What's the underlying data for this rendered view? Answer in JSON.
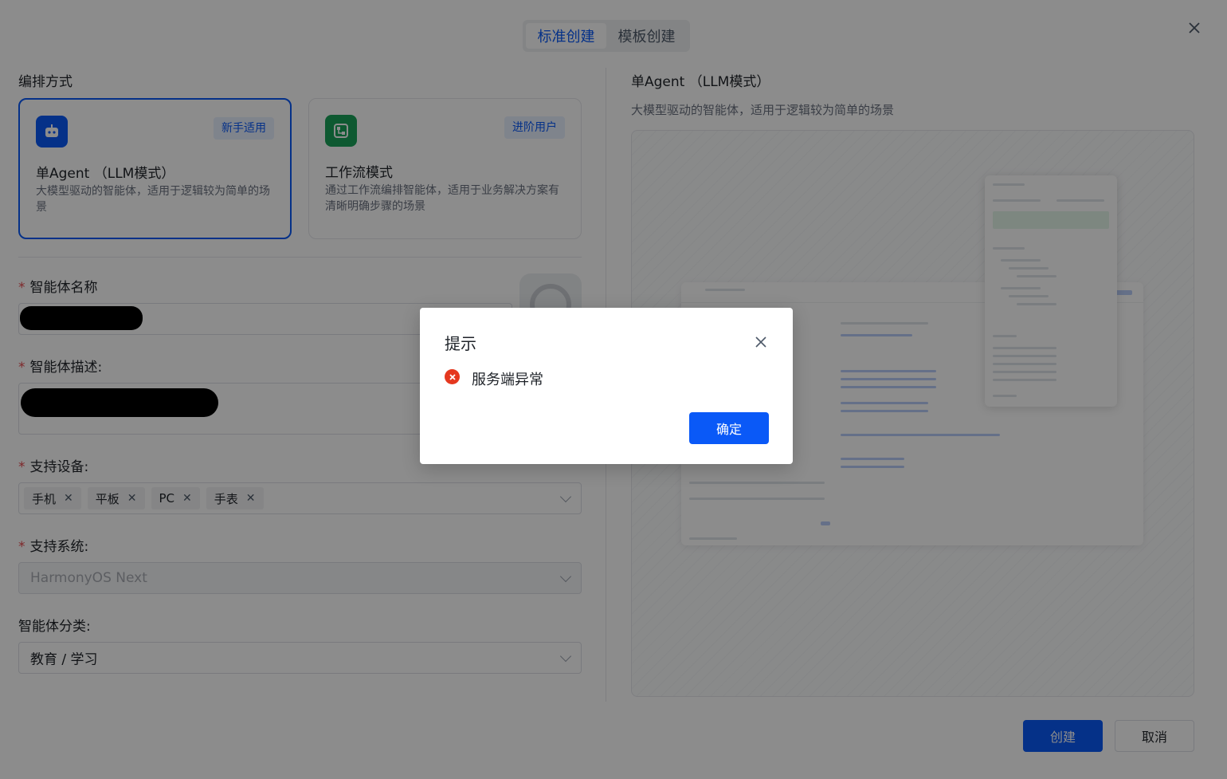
{
  "tabs": [
    {
      "label": "标准创建",
      "active": true
    },
    {
      "label": "模板创建",
      "active": false
    }
  ],
  "orchestration": {
    "label": "编排方式",
    "cards": [
      {
        "icon": "robot-icon",
        "badge": "新手适用",
        "title": "单Agent （LLM模式）",
        "desc": "大模型驱动的智能体，适用于逻辑较为简单的场景",
        "selected": true
      },
      {
        "icon": "workflow-icon",
        "badge": "进阶用户",
        "title": "工作流模式",
        "desc": "通过工作流编排智能体，适用于业务解决方案有清晰明确步骤的场景",
        "selected": false
      }
    ]
  },
  "form": {
    "required_mark": "*",
    "name_label": "智能体名称",
    "desc_label": "智能体描述:",
    "devices_label": "支持设备:",
    "devices": [
      "手机",
      "平板",
      "PC",
      "手表"
    ],
    "tag_remove": "✕",
    "system_label": "支持系统:",
    "system_value": "HarmonyOS Next",
    "category_label": "智能体分类:",
    "category_value": "教育 / 学习"
  },
  "preview": {
    "title": "单Agent （LLM模式）",
    "desc": "大模型驱动的智能体，适用于逻辑较为简单的场景"
  },
  "footer": {
    "create_label": "创建",
    "cancel_label": "取消"
  },
  "dialog": {
    "title": "提示",
    "message": "服务端异常",
    "ok_label": "确定"
  },
  "colors": {
    "primary": "#0a59f7",
    "error": "#e5381f",
    "workflow_icon_bg": "#1aa35a"
  }
}
